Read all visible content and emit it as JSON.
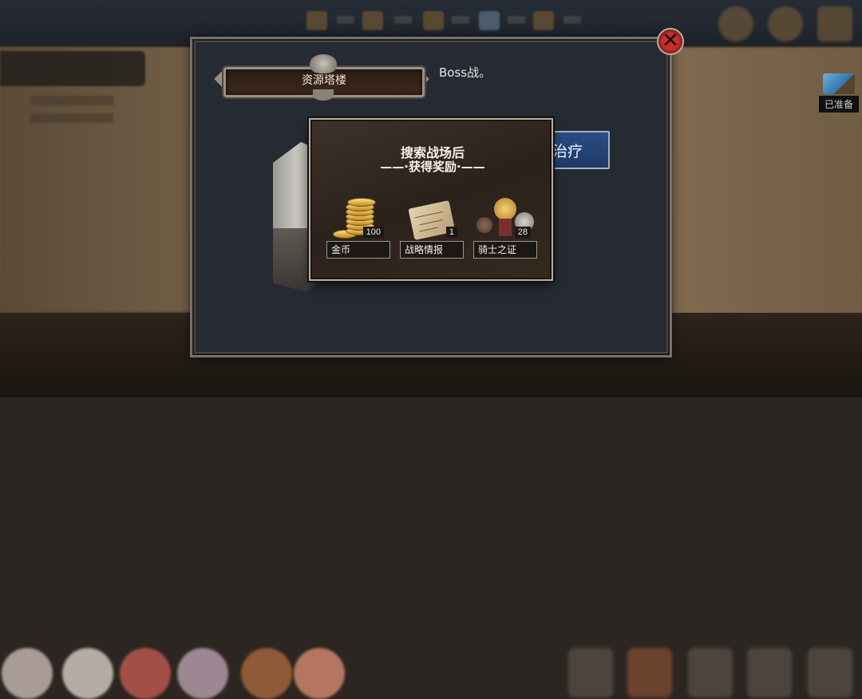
{
  "background": {
    "ready_chip_label": "已准备"
  },
  "panel": {
    "title": "资源塔楼",
    "description": "Boss战。",
    "heal_button_label": "治疗"
  },
  "close_button": {
    "glyph": "✕",
    "icon": "close-icon"
  },
  "reward_popup": {
    "title": "搜索战场后",
    "subtitle": "——·获得奖励·——",
    "items": [
      {
        "name": "金币",
        "count": "100",
        "icon": "gold-coins-icon"
      },
      {
        "name": "战略情报",
        "count": "1",
        "icon": "map-scroll-icon"
      },
      {
        "name": "骑士之证",
        "count": "28",
        "icon": "medal-icon"
      }
    ]
  },
  "colors": {
    "panel_bg": "#252a33",
    "heal_button": "#1e3a68",
    "close_button": "#c32f2c"
  }
}
